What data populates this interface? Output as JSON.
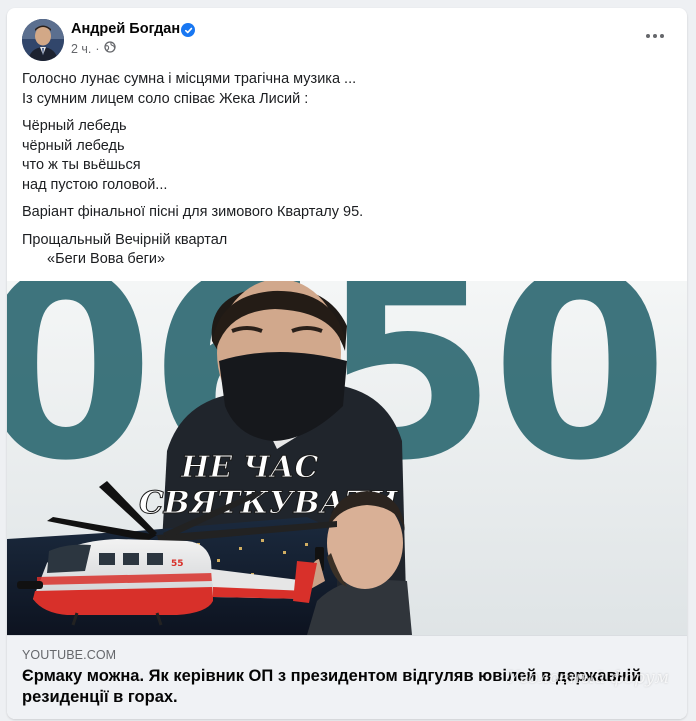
{
  "post": {
    "author": "Андрей Богдан",
    "time": "2 ч.",
    "text": {
      "intro_1": "Голосно лунає сумна і місцями трагічна музика ...",
      "intro_2": "Із сумним лицем соло співає Жека Лисий :",
      "verse_1": "Чёрный  лебедь",
      "verse_2": "чёрный  лебедь",
      "verse_3": "что ж ты вьёшься",
      "verse_4": "над пустою головой...",
      "variant": "Варіант фінальної пісні для зимового Кварталу 95.",
      "farewell_1": "Прощальный Вечірній квартал",
      "farewell_2": "«Беги Вова беги»"
    }
  },
  "media": {
    "big_number": "0650",
    "banner_line_1": "НЕ ЧАС",
    "banner_line_2": "СВЯТКУВАТИ",
    "heli_number": "55"
  },
  "link": {
    "domain": "YOUTUBE.COM",
    "title": "Єрмаку можна. Як керівник ОП з президентом відгуляв ювілей в державній резиденції в горах.",
    "watermark": "Уголовный форум"
  },
  "icons": {
    "verified": "verified-badge-icon",
    "audience": "globe-icon",
    "more": "more-options-icon"
  },
  "colors": {
    "brand_blue": "#1877f2",
    "text_secondary": "#65676b",
    "big_number_fill": "#2f6a73"
  }
}
